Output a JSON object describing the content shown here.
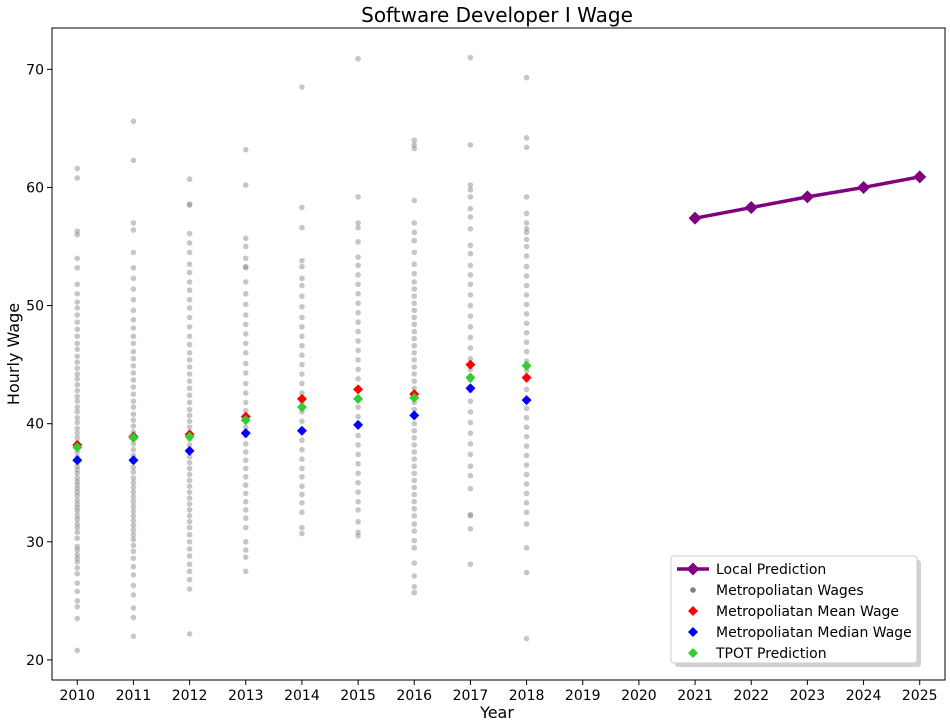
{
  "chart_data": {
    "type": "scatter",
    "title": "Software Developer I Wage",
    "xlabel": "Year",
    "ylabel": "Hourly Wage",
    "xlim": [
      2009.55,
      2025.45
    ],
    "ylim": [
      18.3,
      73.5
    ],
    "x_ticks": [
      2010,
      2011,
      2012,
      2013,
      2014,
      2015,
      2016,
      2017,
      2018,
      2019,
      2020,
      2021,
      2022,
      2023,
      2024,
      2025
    ],
    "y_ticks": [
      20,
      30,
      40,
      50,
      60,
      70
    ],
    "grid": false,
    "legend_position": "lower-right",
    "legend": [
      "Local Prediction",
      "Metropoliatan Wages",
      "Metropoliatan Mean Wage",
      "Metropoliatan Median Wage",
      "TPOT Prediction"
    ],
    "colors": {
      "local_prediction": "#800080",
      "metro_wages": "#808080",
      "mean": "#ff0000",
      "median": "#0000ff",
      "tpot": "#32cd32"
    },
    "series": [
      {
        "name": "Local Prediction",
        "kind": "line",
        "x": [
          2021,
          2022,
          2023,
          2024,
          2025
        ],
        "y": [
          57.4,
          58.3,
          59.2,
          60.0,
          60.9
        ]
      },
      {
        "name": "Metropoliatan Mean Wage",
        "kind": "marker",
        "x": [
          2010,
          2011,
          2012,
          2013,
          2014,
          2015,
          2016,
          2017,
          2018
        ],
        "y": [
          38.2,
          38.9,
          39.1,
          40.6,
          42.1,
          42.9,
          42.5,
          45.0,
          43.9
        ]
      },
      {
        "name": "Metropoliatan Median Wage",
        "kind": "marker",
        "x": [
          2010,
          2011,
          2012,
          2013,
          2014,
          2015,
          2016,
          2017,
          2018
        ],
        "y": [
          36.9,
          36.9,
          37.7,
          39.2,
          39.4,
          39.9,
          40.7,
          43.0,
          42.0
        ]
      },
      {
        "name": "TPOT Prediction",
        "kind": "marker",
        "x": [
          2010,
          2011,
          2012,
          2013,
          2014,
          2015,
          2016,
          2017,
          2018
        ],
        "y": [
          38.0,
          38.8,
          38.9,
          40.3,
          41.4,
          42.1,
          42.2,
          43.9,
          44.9
        ]
      },
      {
        "name": "Metropoliatan Wages",
        "kind": "scatter",
        "points_by_year": [
          {
            "x": 2010,
            "y": [
              20.8,
              23.5,
              24.5,
              25.0,
              25.8,
              26.5,
              27.3,
              27.8,
              28.3,
              28.6,
              28.9,
              29.3,
              29.6,
              30.3,
              30.8,
              31.2,
              31.5,
              31.9,
              32.2,
              32.6,
              32.9,
              33.2,
              33.5,
              33.9,
              34.2,
              34.5,
              34.8,
              35.1,
              35.4,
              35.8,
              36.1,
              36.4,
              36.8,
              37.2,
              37.6,
              38.0,
              38.4,
              38.8,
              39.2,
              39.6,
              40.1,
              40.5,
              41.0,
              41.4,
              41.9,
              42.3,
              42.8,
              43.3,
              43.8,
              44.2,
              44.7,
              45.2,
              45.7,
              46.3,
              46.8,
              47.4,
              48.0,
              48.6,
              49.2,
              49.8,
              50.3,
              51.0,
              51.8,
              53.2,
              54.0,
              56.0,
              56.3,
              60.8,
              61.6
            ]
          },
          {
            "x": 2011,
            "y": [
              22.0,
              23.6,
              24.4,
              25.5,
              26.3,
              27.2,
              27.9,
              28.6,
              29.2,
              29.7,
              30.2,
              30.6,
              31.0,
              31.4,
              31.8,
              32.2,
              32.6,
              33.0,
              33.4,
              33.8,
              34.2,
              34.6,
              35.0,
              35.4,
              35.9,
              36.3,
              36.8,
              37.3,
              37.8,
              38.3,
              38.8,
              39.3,
              39.8,
              40.3,
              40.8,
              41.4,
              41.9,
              42.5,
              43.1,
              43.7,
              44.3,
              44.9,
              45.5,
              46.1,
              46.8,
              47.4,
              48.1,
              48.8,
              49.6,
              50.5,
              51.4,
              52.3,
              53.2,
              54.5,
              56.4,
              57.0,
              62.3,
              65.6
            ]
          },
          {
            "x": 2012,
            "y": [
              22.2,
              26.0,
              26.8,
              27.5,
              28.1,
              28.8,
              29.4,
              30.0,
              30.6,
              31.2,
              31.7,
              32.2,
              32.7,
              33.2,
              33.7,
              34.2,
              34.7,
              35.2,
              35.7,
              36.2,
              36.7,
              37.2,
              37.7,
              38.2,
              38.7,
              39.2,
              39.7,
              40.2,
              40.7,
              41.2,
              41.8,
              42.4,
              43.0,
              43.6,
              44.2,
              44.8,
              45.4,
              46.0,
              46.7,
              47.4,
              48.2,
              49.0,
              49.8,
              50.5,
              51.3,
              52.0,
              52.8,
              53.5,
              54.5,
              55.3,
              56.1,
              58.5,
              58.6,
              60.7
            ]
          },
          {
            "x": 2013,
            "y": [
              27.5,
              28.7,
              29.3,
              30.0,
              31.2,
              32.0,
              32.7,
              33.4,
              34.1,
              34.8,
              35.5,
              36.2,
              36.9,
              37.6,
              38.3,
              39.0,
              39.7,
              40.4,
              41.1,
              41.8,
              42.6,
              43.4,
              44.3,
              45.1,
              46.0,
              46.8,
              47.6,
              48.4,
              49.2,
              50.1,
              51.0,
              52.0,
              53.2,
              53.3,
              54.0,
              55.0,
              55.7,
              60.2,
              63.2
            ]
          },
          {
            "x": 2014,
            "y": [
              30.7,
              31.2,
              32.5,
              33.3,
              34.0,
              34.7,
              35.5,
              36.2,
              37.0,
              37.8,
              38.6,
              39.4,
              40.2,
              41.0,
              41.8,
              42.6,
              43.4,
              44.2,
              45.0,
              45.8,
              46.6,
              47.4,
              48.2,
              49.0,
              49.9,
              50.8,
              51.7,
              52.3,
              53.3,
              53.8,
              56.6,
              58.3,
              68.5
            ]
          },
          {
            "x": 2015,
            "y": [
              30.5,
              30.8,
              31.7,
              32.7,
              33.4,
              34.2,
              35.0,
              35.8,
              36.6,
              37.4,
              38.2,
              39.0,
              39.8,
              40.6,
              41.4,
              42.2,
              43.0,
              43.8,
              44.6,
              45.4,
              46.2,
              47.0,
              47.8,
              48.6,
              49.4,
              50.2,
              51.0,
              51.8,
              52.6,
              53.4,
              54.1,
              55.4,
              56.6,
              57.0,
              59.2,
              70.9
            ]
          },
          {
            "x": 2016,
            "y": [
              25.7,
              26.2,
              27.1,
              28.2,
              29.5,
              30.1,
              30.9,
              31.5,
              32.2,
              32.8,
              33.4,
              34.0,
              34.6,
              35.2,
              35.8,
              36.4,
              37.0,
              37.6,
              38.2,
              38.8,
              39.4,
              40.0,
              40.6,
              41.2,
              41.8,
              42.4,
              43.0,
              43.6,
              44.2,
              44.8,
              45.4,
              46.0,
              46.6,
              47.2,
              47.8,
              48.4,
              49.0,
              49.6,
              50.2,
              50.8,
              51.4,
              52.0,
              52.7,
              53.5,
              54.5,
              55.5,
              56.2,
              57.0,
              58.9,
              63.3,
              63.6,
              64.0
            ]
          },
          {
            "x": 2017,
            "y": [
              28.1,
              31.1,
              32.2,
              32.3,
              34.5,
              35.6,
              36.4,
              37.4,
              38.3,
              39.2,
              40.1,
              41.0,
              41.9,
              42.8,
              43.7,
              44.6,
              45.5,
              46.4,
              47.3,
              48.2,
              49.1,
              50.0,
              50.9,
              51.8,
              52.6,
              53.4,
              54.4,
              55.1,
              56.5,
              57.5,
              58.2,
              59.2,
              59.8,
              60.2,
              63.6,
              71.0
            ]
          },
          {
            "x": 2018,
            "y": [
              21.8,
              27.4,
              29.5,
              31.5,
              32.5,
              33.3,
              34.1,
              34.9,
              35.7,
              36.5,
              37.3,
              38.1,
              38.9,
              39.7,
              40.5,
              41.3,
              42.1,
              42.9,
              43.7,
              44.5,
              45.3,
              46.1,
              46.9,
              47.7,
              48.5,
              49.3,
              50.1,
              50.9,
              51.7,
              52.5,
              53.3,
              54.2,
              55.0,
              55.6,
              56.2,
              56.5,
              57.0,
              57.8,
              59.2,
              63.4,
              64.2,
              69.3
            ]
          }
        ]
      }
    ]
  }
}
